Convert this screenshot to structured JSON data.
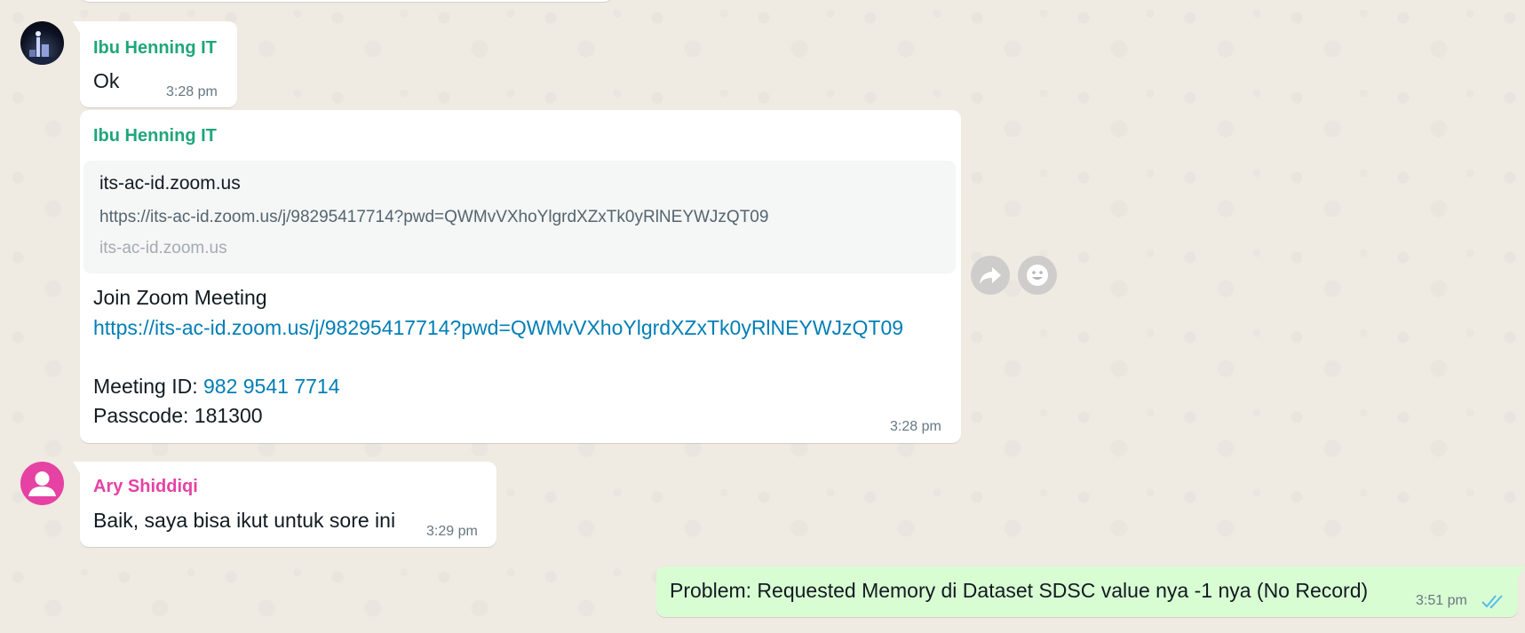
{
  "messages": [
    {
      "sender": "Ibu Henning IT",
      "text": "Ok",
      "time": "3:28 pm"
    },
    {
      "sender": "Ibu Henning IT",
      "preview": {
        "title": "its-ac-id.zoom.us",
        "url": "https://its-ac-id.zoom.us/j/98295417714?pwd=QWMvVXhoYlgrdXZxTk0yRlNEYWJzQT09",
        "domain": "its-ac-id.zoom.us"
      },
      "line1": "Join Zoom Meeting",
      "link": "https://its-ac-id.zoom.us/j/98295417714?pwd=QWMvVXhoYlgrdXZxTk0yRlNEYWJzQT09",
      "meeting_id_label": "Meeting ID: ",
      "meeting_id": "982 9541 7714",
      "passcode": "Passcode: 181300",
      "time": "3:28 pm"
    },
    {
      "sender": "Ary Shiddiqi",
      "text": "Baik, saya bisa ikut untuk sore ini",
      "time": "3:29 pm"
    },
    {
      "text": "Problem: Requested Memory di Dataset SDSC value nya -1 nya (No Record)",
      "time": "3:51 pm",
      "status": "double-check-icon"
    }
  ],
  "actions": {
    "forward": "forward-icon",
    "react": "emoji-icon"
  },
  "colors": {
    "background": "#efeae2",
    "incoming": "#ffffff",
    "outgoing": "#d9fdd3",
    "sender_green": "#1fa67a",
    "sender_pink": "#e542a3",
    "link": "#027eb5",
    "read_tick": "#53bdeb"
  }
}
